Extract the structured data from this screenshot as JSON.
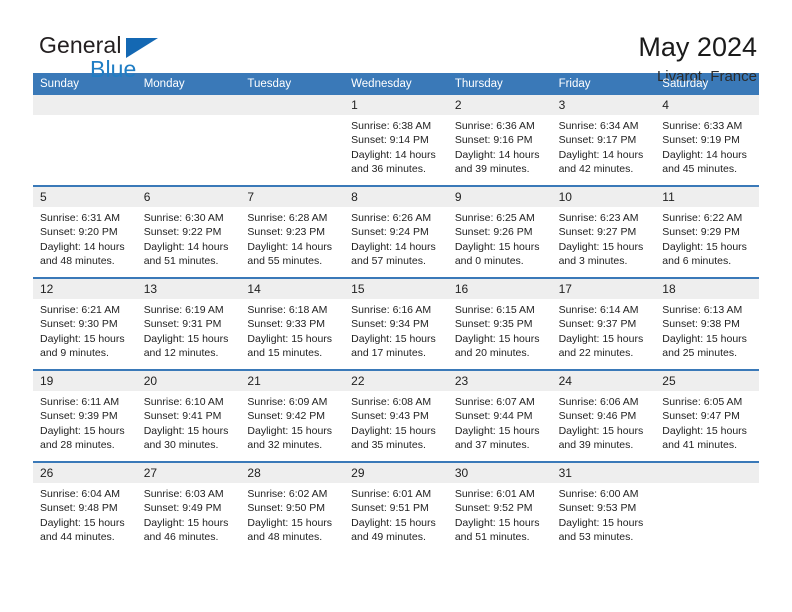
{
  "brand": {
    "name_dark": "General",
    "name_light": "Blue",
    "triangle_icon": "triangle-icon",
    "accent_color": "#1468b3",
    "light_color": "#1f7dc4"
  },
  "header": {
    "title": "May 2024",
    "subtitle": "Livarot, France"
  },
  "theme": {
    "header_bar": "#3a79b8",
    "daynum_band": "#eeeeee",
    "text": "#222222"
  },
  "weekdays": [
    "Sunday",
    "Monday",
    "Tuesday",
    "Wednesday",
    "Thursday",
    "Friday",
    "Saturday"
  ],
  "weeks": [
    [
      {
        "day": "",
        "lines": []
      },
      {
        "day": "",
        "lines": []
      },
      {
        "day": "",
        "lines": []
      },
      {
        "day": "1",
        "lines": [
          "Sunrise: 6:38 AM",
          "Sunset: 9:14 PM",
          "Daylight: 14 hours",
          "and 36 minutes."
        ]
      },
      {
        "day": "2",
        "lines": [
          "Sunrise: 6:36 AM",
          "Sunset: 9:16 PM",
          "Daylight: 14 hours",
          "and 39 minutes."
        ]
      },
      {
        "day": "3",
        "lines": [
          "Sunrise: 6:34 AM",
          "Sunset: 9:17 PM",
          "Daylight: 14 hours",
          "and 42 minutes."
        ]
      },
      {
        "day": "4",
        "lines": [
          "Sunrise: 6:33 AM",
          "Sunset: 9:19 PM",
          "Daylight: 14 hours",
          "and 45 minutes."
        ]
      }
    ],
    [
      {
        "day": "5",
        "lines": [
          "Sunrise: 6:31 AM",
          "Sunset: 9:20 PM",
          "Daylight: 14 hours",
          "and 48 minutes."
        ]
      },
      {
        "day": "6",
        "lines": [
          "Sunrise: 6:30 AM",
          "Sunset: 9:22 PM",
          "Daylight: 14 hours",
          "and 51 minutes."
        ]
      },
      {
        "day": "7",
        "lines": [
          "Sunrise: 6:28 AM",
          "Sunset: 9:23 PM",
          "Daylight: 14 hours",
          "and 55 minutes."
        ]
      },
      {
        "day": "8",
        "lines": [
          "Sunrise: 6:26 AM",
          "Sunset: 9:24 PM",
          "Daylight: 14 hours",
          "and 57 minutes."
        ]
      },
      {
        "day": "9",
        "lines": [
          "Sunrise: 6:25 AM",
          "Sunset: 9:26 PM",
          "Daylight: 15 hours",
          "and 0 minutes."
        ]
      },
      {
        "day": "10",
        "lines": [
          "Sunrise: 6:23 AM",
          "Sunset: 9:27 PM",
          "Daylight: 15 hours",
          "and 3 minutes."
        ]
      },
      {
        "day": "11",
        "lines": [
          "Sunrise: 6:22 AM",
          "Sunset: 9:29 PM",
          "Daylight: 15 hours",
          "and 6 minutes."
        ]
      }
    ],
    [
      {
        "day": "12",
        "lines": [
          "Sunrise: 6:21 AM",
          "Sunset: 9:30 PM",
          "Daylight: 15 hours",
          "and 9 minutes."
        ]
      },
      {
        "day": "13",
        "lines": [
          "Sunrise: 6:19 AM",
          "Sunset: 9:31 PM",
          "Daylight: 15 hours",
          "and 12 minutes."
        ]
      },
      {
        "day": "14",
        "lines": [
          "Sunrise: 6:18 AM",
          "Sunset: 9:33 PM",
          "Daylight: 15 hours",
          "and 15 minutes."
        ]
      },
      {
        "day": "15",
        "lines": [
          "Sunrise: 6:16 AM",
          "Sunset: 9:34 PM",
          "Daylight: 15 hours",
          "and 17 minutes."
        ]
      },
      {
        "day": "16",
        "lines": [
          "Sunrise: 6:15 AM",
          "Sunset: 9:35 PM",
          "Daylight: 15 hours",
          "and 20 minutes."
        ]
      },
      {
        "day": "17",
        "lines": [
          "Sunrise: 6:14 AM",
          "Sunset: 9:37 PM",
          "Daylight: 15 hours",
          "and 22 minutes."
        ]
      },
      {
        "day": "18",
        "lines": [
          "Sunrise: 6:13 AM",
          "Sunset: 9:38 PM",
          "Daylight: 15 hours",
          "and 25 minutes."
        ]
      }
    ],
    [
      {
        "day": "19",
        "lines": [
          "Sunrise: 6:11 AM",
          "Sunset: 9:39 PM",
          "Daylight: 15 hours",
          "and 28 minutes."
        ]
      },
      {
        "day": "20",
        "lines": [
          "Sunrise: 6:10 AM",
          "Sunset: 9:41 PM",
          "Daylight: 15 hours",
          "and 30 minutes."
        ]
      },
      {
        "day": "21",
        "lines": [
          "Sunrise: 6:09 AM",
          "Sunset: 9:42 PM",
          "Daylight: 15 hours",
          "and 32 minutes."
        ]
      },
      {
        "day": "22",
        "lines": [
          "Sunrise: 6:08 AM",
          "Sunset: 9:43 PM",
          "Daylight: 15 hours",
          "and 35 minutes."
        ]
      },
      {
        "day": "23",
        "lines": [
          "Sunrise: 6:07 AM",
          "Sunset: 9:44 PM",
          "Daylight: 15 hours",
          "and 37 minutes."
        ]
      },
      {
        "day": "24",
        "lines": [
          "Sunrise: 6:06 AM",
          "Sunset: 9:46 PM",
          "Daylight: 15 hours",
          "and 39 minutes."
        ]
      },
      {
        "day": "25",
        "lines": [
          "Sunrise: 6:05 AM",
          "Sunset: 9:47 PM",
          "Daylight: 15 hours",
          "and 41 minutes."
        ]
      }
    ],
    [
      {
        "day": "26",
        "lines": [
          "Sunrise: 6:04 AM",
          "Sunset: 9:48 PM",
          "Daylight: 15 hours",
          "and 44 minutes."
        ]
      },
      {
        "day": "27",
        "lines": [
          "Sunrise: 6:03 AM",
          "Sunset: 9:49 PM",
          "Daylight: 15 hours",
          "and 46 minutes."
        ]
      },
      {
        "day": "28",
        "lines": [
          "Sunrise: 6:02 AM",
          "Sunset: 9:50 PM",
          "Daylight: 15 hours",
          "and 48 minutes."
        ]
      },
      {
        "day": "29",
        "lines": [
          "Sunrise: 6:01 AM",
          "Sunset: 9:51 PM",
          "Daylight: 15 hours",
          "and 49 minutes."
        ]
      },
      {
        "day": "30",
        "lines": [
          "Sunrise: 6:01 AM",
          "Sunset: 9:52 PM",
          "Daylight: 15 hours",
          "and 51 minutes."
        ]
      },
      {
        "day": "31",
        "lines": [
          "Sunrise: 6:00 AM",
          "Sunset: 9:53 PM",
          "Daylight: 15 hours",
          "and 53 minutes."
        ]
      },
      {
        "day": "",
        "lines": []
      }
    ]
  ]
}
